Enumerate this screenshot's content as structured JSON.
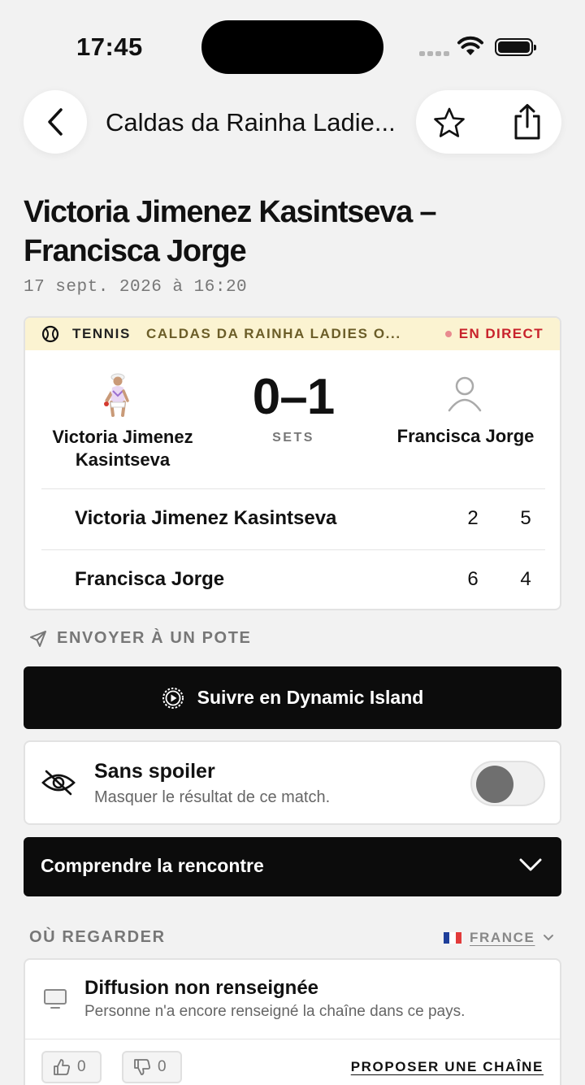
{
  "status_bar": {
    "time": "17:45"
  },
  "nav": {
    "title": "Caldas da Rainha Ladie..."
  },
  "match": {
    "title": "Victoria Jimenez Kasintseva – Francisca Jorge",
    "date": "17 sept. 2026 à 16:20"
  },
  "score_card": {
    "sport": "TENNIS",
    "tournament": "CALDAS DA RAINHA LADIES O...",
    "live_label": "EN DIRECT",
    "player1_name": "Victoria Jimenez Kasintseva",
    "player2_name": "Francisca Jorge",
    "score": "0–1",
    "score_unit": "SETS",
    "sets": [
      {
        "player": "Victoria Jimenez Kasintseva",
        "scores": [
          "2",
          "5"
        ]
      },
      {
        "player": "Francisca Jorge",
        "scores": [
          "6",
          "4"
        ]
      }
    ],
    "colors": {
      "header_bg": "#fbf3d1",
      "live": "#c8222b"
    }
  },
  "share": {
    "label": "ENVOYER À UN POTE"
  },
  "dynamic_island_button": {
    "label": "Suivre en Dynamic Island"
  },
  "spoiler": {
    "title": "Sans spoiler",
    "subtitle": "Masquer le résultat de ce match.",
    "enabled": false
  },
  "understand": {
    "label": "Comprendre la rencontre"
  },
  "where_to_watch": {
    "heading": "OÙ REGARDER",
    "country": "FRANCE",
    "broadcast_title": "Diffusion non renseignée",
    "broadcast_subtitle": "Personne n'a encore renseigné la chaîne dans ce pays.",
    "upvotes": "0",
    "downvotes": "0",
    "propose_label": "PROPOSER UNE CHAÎNE"
  }
}
